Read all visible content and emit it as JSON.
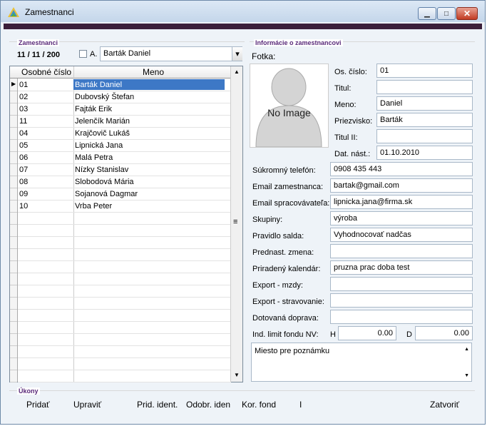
{
  "window": {
    "title": "Zamestnanci",
    "minimize": "▁",
    "maximize": "□",
    "close": "✕"
  },
  "left": {
    "group_label": "Zamestnanci",
    "count": "11 / 11 / 200",
    "checkbox_label": "A.",
    "combo_value": "Barták Daniel",
    "combo_arrow": "▾",
    "columns": [
      "Osobné číslo",
      "Meno"
    ],
    "rows": [
      {
        "id": "01",
        "name": "Barták Daniel"
      },
      {
        "id": "02",
        "name": "Dubovský Štefan"
      },
      {
        "id": "03",
        "name": "Fajták Erik"
      },
      {
        "id": "11",
        "name": "Jelenčík Marián"
      },
      {
        "id": "04",
        "name": "Krajčovič Lukáš"
      },
      {
        "id": "05",
        "name": "Lipnická Jana"
      },
      {
        "id": "06",
        "name": "Malá Petra"
      },
      {
        "id": "07",
        "name": "Nízky Stanislav"
      },
      {
        "id": "08",
        "name": "Slobodová Mária"
      },
      {
        "id": "09",
        "name": "Sojanová Dagmar"
      },
      {
        "id": "10",
        "name": "Vrba Peter"
      }
    ],
    "selected_marker": "▶",
    "scroll_up": "▲",
    "scroll_mid": "≡",
    "scroll_down": "▼"
  },
  "right": {
    "group_label": "Informácie o zamestnancovi",
    "photo_label": "Fotka:",
    "no_image": "No Image",
    "os_cislo_label": "Os. číslo:",
    "os_cislo": "01",
    "titul_label": "Titul:",
    "titul": "",
    "meno_label": "Meno:",
    "meno": "Daniel",
    "priezvisko_label": "Priezvisko:",
    "priezvisko": "Barták",
    "titul2_label": "Titul II:",
    "titul2": "",
    "dat_nast_label": "Dat. nást.:",
    "dat_nast": "01.10.2010",
    "phone_label": "Súkromný telefón:",
    "phone": "0908 435 443",
    "email_label": "Email zamestnanca:",
    "email": "bartak@gmail.com",
    "email_proc_label": "Email spracovávateľa:",
    "email_proc": "lipnicka.jana@firma.sk",
    "skupiny_label": "Skupiny:",
    "skupiny": "výroba",
    "saldo_label": "Pravidlo salda:",
    "saldo": "Vyhodnocovať nadčas",
    "zmena_label": "Prednast. zmena:",
    "zmena": "",
    "kalendar_label": "Priradený kalendár:",
    "kalendar": "pruzna prac doba test",
    "export_mzdy_label": "Export - mzdy:",
    "export_mzdy": "",
    "export_strav_label": "Export - stravovanie:",
    "export_strav": "",
    "doprava_label": "Dotovaná doprava:",
    "doprava": "",
    "limit_label": "Ind. limit fondu NV:",
    "h_label": "H",
    "h_value": "0.00",
    "d_label": "D",
    "d_value": "0.00",
    "note": "Miesto pre poznámku"
  },
  "actions": {
    "group_label": "Úkony",
    "pridat": "Pridať",
    "upravit": "Upraviť",
    "prid_ident": "Prid. ident.",
    "odobr_iden": "Odobr. iden",
    "kor_fond": "Kor. fond",
    "sep": "I",
    "zatvorit": "Zatvoriť"
  }
}
